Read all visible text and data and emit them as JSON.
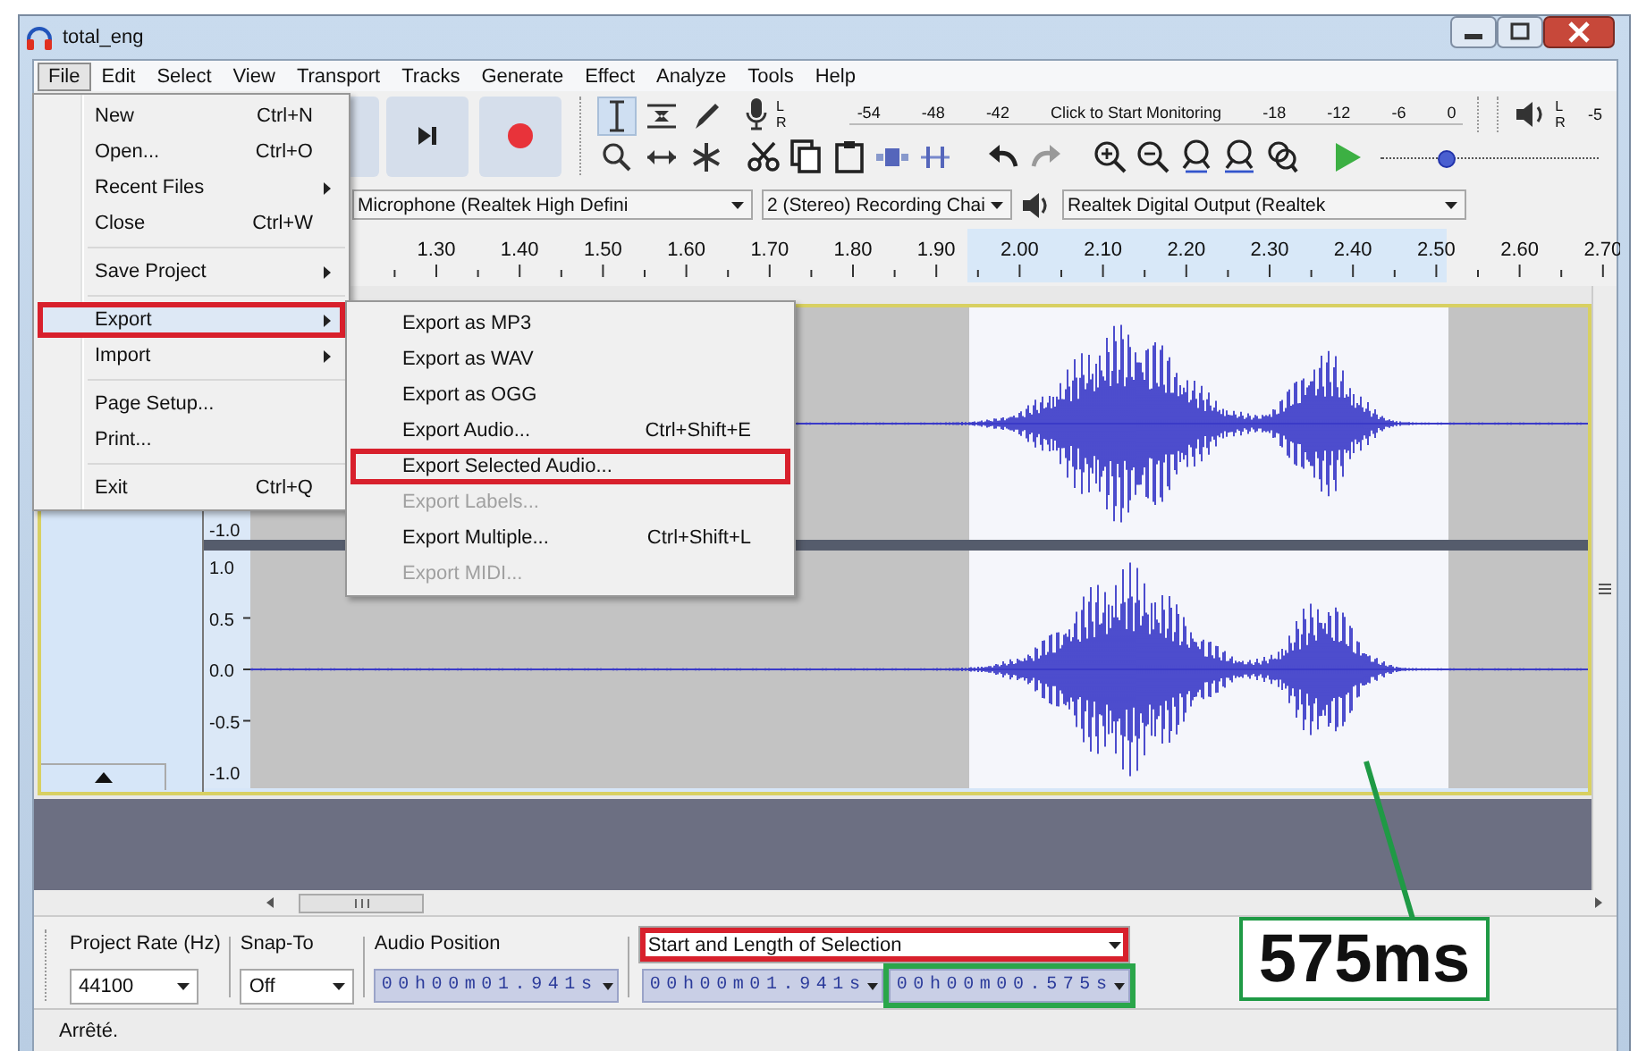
{
  "window": {
    "title": "total_eng"
  },
  "menu_bar": [
    {
      "label": "File",
      "selected": true
    },
    {
      "label": "Edit",
      "selected": false
    },
    {
      "label": "Select",
      "selected": false
    },
    {
      "label": "View",
      "selected": false
    },
    {
      "label": "Transport",
      "selected": false
    },
    {
      "label": "Tracks",
      "selected": false
    },
    {
      "label": "Generate",
      "selected": false
    },
    {
      "label": "Effect",
      "selected": false
    },
    {
      "label": "Analyze",
      "selected": false
    },
    {
      "label": "Tools",
      "selected": false
    },
    {
      "label": "Help",
      "selected": false
    }
  ],
  "meters": {
    "record_channels": [
      "L",
      "R"
    ],
    "record_scale": [
      "-54",
      "-48",
      "-42",
      "Click to Start Monitoring",
      "-18",
      "-12",
      "-6",
      "0"
    ],
    "play_channels": [
      "L",
      "R"
    ],
    "play_scale": [
      "-5"
    ]
  },
  "play_speed": {
    "level": 0.3
  },
  "devices": {
    "input": "Microphone (Realtek High Defini",
    "channels": "2 (Stereo) Recording Chai",
    "output": "Realtek Digital Output (Realtek"
  },
  "ruler": {
    "ticks": [
      "1.30",
      "1.40",
      "1.50",
      "1.60",
      "1.70",
      "1.80",
      "1.90",
      "2.00",
      "2.10",
      "2.20",
      "2.30",
      "2.40",
      "2.50",
      "2.60",
      "2.70"
    ]
  },
  "track": {
    "channels": [
      {
        "scale": [
          "-1.0"
        ]
      },
      {
        "scale": [
          "1.0",
          "0.5",
          "0.0",
          "-0.5",
          "-1.0"
        ]
      }
    ]
  },
  "file_menu": {
    "items": [
      {
        "kind": "item",
        "label": "New",
        "shortcut": "Ctrl+N",
        "selected": false,
        "marked": false
      },
      {
        "kind": "item",
        "label": "Open...",
        "shortcut": "Ctrl+O",
        "selected": false,
        "marked": false
      },
      {
        "kind": "submenu",
        "label": "Recent Files",
        "selected": false,
        "marked": false
      },
      {
        "kind": "item",
        "label": "Close",
        "shortcut": "Ctrl+W",
        "selected": false,
        "marked": false
      },
      {
        "kind": "separator"
      },
      {
        "kind": "submenu",
        "label": "Save Project",
        "selected": false,
        "marked": false
      },
      {
        "kind": "separator"
      },
      {
        "kind": "submenu",
        "label": "Export",
        "selected": true,
        "marked": true
      },
      {
        "kind": "submenu",
        "label": "Import",
        "selected": false,
        "marked": false
      },
      {
        "kind": "separator"
      },
      {
        "kind": "item",
        "label": "Page Setup...",
        "selected": false,
        "marked": false
      },
      {
        "kind": "item",
        "label": "Print...",
        "selected": false,
        "marked": false
      },
      {
        "kind": "separator"
      },
      {
        "kind": "item",
        "label": "Exit",
        "shortcut": "Ctrl+Q",
        "selected": false,
        "marked": false
      }
    ]
  },
  "export_menu": {
    "items": [
      {
        "label": "Export as MP3",
        "disabled": false,
        "marked": false
      },
      {
        "label": "Export as WAV",
        "disabled": false,
        "marked": false
      },
      {
        "label": "Export as OGG",
        "disabled": false,
        "marked": false
      },
      {
        "label": "Export Audio...",
        "shortcut": "Ctrl+Shift+E",
        "disabled": false,
        "marked": false
      },
      {
        "label": "Export Selected Audio...",
        "disabled": false,
        "marked": true
      },
      {
        "label": "Export Labels...",
        "disabled": true,
        "marked": false
      },
      {
        "label": "Export Multiple...",
        "shortcut": "Ctrl+Shift+L",
        "disabled": false,
        "marked": false
      },
      {
        "label": "Export MIDI...",
        "disabled": true,
        "marked": false
      }
    ]
  },
  "selection_toolbar": {
    "project_rate_label": "Project Rate (Hz)",
    "project_rate": "44100",
    "snap_to_label": "Snap-To",
    "snap_to": "Off",
    "audio_position_label": "Audio Position",
    "audio_position": "00h00m01.941s",
    "mode": "Start and Length of Selection",
    "mode_marked": true,
    "selection_start": "00h00m01.941s",
    "selection_length": "00h00m00.575s",
    "length_marked": true
  },
  "status_bar": {
    "text": "Arrêté."
  },
  "annotation": {
    "text": "575ms"
  }
}
